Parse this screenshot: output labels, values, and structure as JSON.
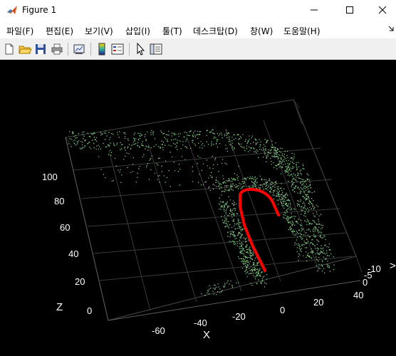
{
  "window": {
    "title": "Figure 1",
    "icon": "matlab-icon",
    "controls": [
      "minimize-icon",
      "maximize-icon",
      "close-icon"
    ]
  },
  "menu": [
    {
      "label": "파일(F)"
    },
    {
      "label": "편집(E)"
    },
    {
      "label": "보기(V)"
    },
    {
      "label": "삽입(I)"
    },
    {
      "label": "툴(T)"
    },
    {
      "label": "데스크탑(D)"
    },
    {
      "label": "창(W)"
    },
    {
      "label": "도움말(H)"
    }
  ],
  "toolbar": [
    "new-figure-icon",
    "open-file-icon",
    "save-icon",
    "print-icon",
    "link-plot-icon",
    "insert-colorbar-icon",
    "insert-legend-icon",
    "edit-plot-icon",
    "property-inspector-icon"
  ],
  "plot": {
    "background": "#000000",
    "point_color": "#8fd07f",
    "trajectory_color": "#ff0000",
    "axes": {
      "x_label": "X",
      "z_label": "Z",
      "x_ticks": [
        "-60",
        "-40",
        "-20",
        "0",
        "20",
        "40"
      ],
      "y_ticks": [
        "0",
        "-5",
        "-10"
      ],
      "z_ticks": [
        "0",
        "20",
        "40",
        "60",
        "80",
        "100"
      ]
    }
  }
}
